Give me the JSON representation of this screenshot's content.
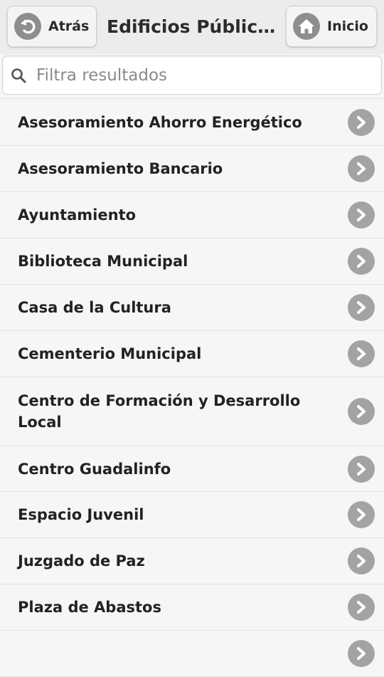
{
  "header": {
    "title": "Edificios Públicos",
    "back_label": "Atrás",
    "home_label": "Inicio"
  },
  "search": {
    "placeholder": "Filtra resultados",
    "value": ""
  },
  "list": {
    "items": [
      {
        "label": "Asesoramiento Ahorro Energético"
      },
      {
        "label": "Asesoramiento Bancario"
      },
      {
        "label": "Ayuntamiento"
      },
      {
        "label": "Biblioteca Municipal"
      },
      {
        "label": "Casa de la Cultura"
      },
      {
        "label": "Cementerio Municipal"
      },
      {
        "label": "Centro de Formación y Desarrollo Local"
      },
      {
        "label": "Centro Guadalinfo"
      },
      {
        "label": "Espacio Juvenil"
      },
      {
        "label": "Juzgado de Paz"
      },
      {
        "label": "Plaza de Abastos"
      },
      {
        "label": ""
      }
    ]
  },
  "icons": {
    "back": "arrow-back-icon",
    "home": "home-icon",
    "search": "search-icon",
    "chevron": "chevron-right-icon"
  },
  "colors": {
    "header_bg": "#ececec",
    "icon_gray": "#8e8e8e",
    "chevron_gray": "#a3a3a3"
  }
}
